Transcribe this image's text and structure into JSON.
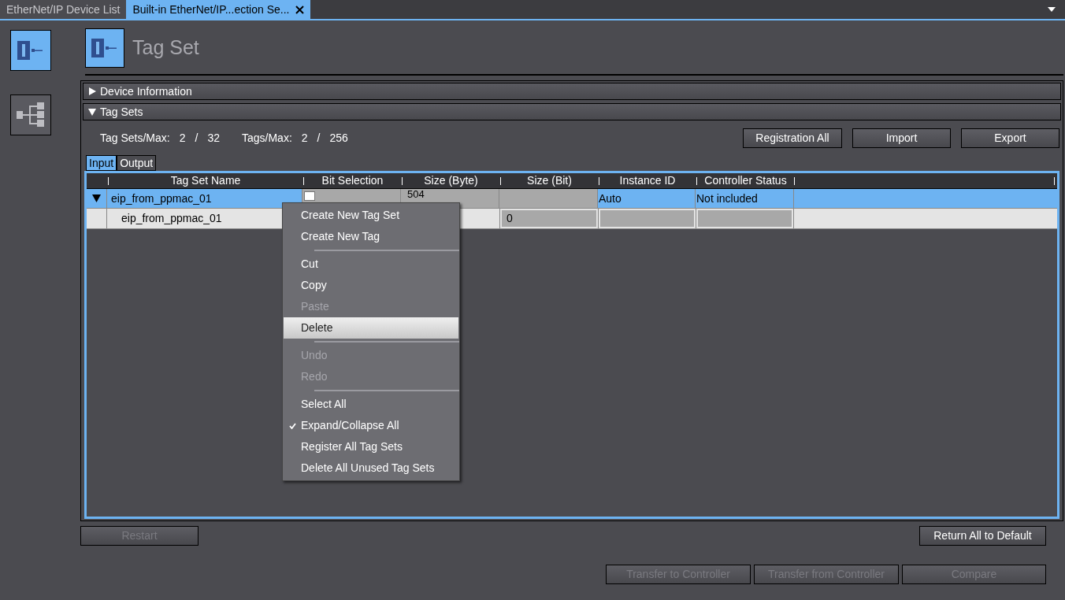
{
  "tabs": [
    {
      "label": "EtherNet/IP Device List",
      "selected": false,
      "closable": false
    },
    {
      "label": "Built-in EtherNet/IP...ection Se...",
      "selected": true,
      "closable": true
    }
  ],
  "sidebar": {
    "items": [
      {
        "kind": "device",
        "selected": true
      },
      {
        "kind": "tree",
        "selected": false
      }
    ]
  },
  "header": {
    "title": "Tag Set"
  },
  "sections": [
    {
      "label": "Device Information",
      "expanded": false
    },
    {
      "label": "Tag Sets",
      "expanded": true
    }
  ],
  "stats": [
    {
      "label": "Tag Sets/Max:",
      "used": "2",
      "sep": "/",
      "max": "32"
    },
    {
      "label": "Tags/Max:",
      "used": "2",
      "sep": "/",
      "max": "256"
    }
  ],
  "toolbar": [
    {
      "label": "Registration All",
      "disabled": false
    },
    {
      "label": "Import",
      "disabled": false
    },
    {
      "label": "Export",
      "disabled": false
    }
  ],
  "subtabs": [
    {
      "label": "Input",
      "selected": true
    },
    {
      "label": "Output",
      "selected": false
    }
  ],
  "table": {
    "columns": [
      "Tag Set Name",
      "Bit Selection",
      "Size (Byte)",
      "Size (Bit)",
      "Instance ID",
      "Controller Status"
    ],
    "rows": [
      {
        "expanded": true,
        "selected": true,
        "name": "eip_from_ppmac_01",
        "bit_selection": {
          "checked": false
        },
        "size_byte": "504",
        "instance_id": "Auto",
        "controller_status": "Not included",
        "children": [
          {
            "name": "eip_from_ppmac_01",
            "size_bit": "0"
          }
        ]
      }
    ]
  },
  "context_menu": [
    {
      "kind": "item",
      "label": "Create New Tag Set",
      "disabled": false,
      "selected": false,
      "checked": false
    },
    {
      "kind": "item",
      "label": "Create New Tag",
      "disabled": false,
      "selected": false,
      "checked": false
    },
    {
      "kind": "separator"
    },
    {
      "kind": "item",
      "label": "Cut",
      "disabled": false,
      "selected": false,
      "checked": false
    },
    {
      "kind": "item",
      "label": "Copy",
      "disabled": false,
      "selected": false,
      "checked": false
    },
    {
      "kind": "item",
      "label": "Paste",
      "disabled": true,
      "selected": false,
      "checked": false
    },
    {
      "kind": "item",
      "label": "Delete",
      "disabled": false,
      "selected": true,
      "checked": false
    },
    {
      "kind": "separator"
    },
    {
      "kind": "item",
      "label": "Undo",
      "disabled": true,
      "selected": false,
      "checked": false
    },
    {
      "kind": "item",
      "label": "Redo",
      "disabled": true,
      "selected": false,
      "checked": false
    },
    {
      "kind": "separator"
    },
    {
      "kind": "item",
      "label": "Select All",
      "disabled": false,
      "selected": false,
      "checked": false
    },
    {
      "kind": "item",
      "label": "Expand/Collapse All",
      "disabled": false,
      "selected": false,
      "checked": true
    },
    {
      "kind": "item",
      "label": "Register All Tag Sets",
      "disabled": false,
      "selected": false,
      "checked": false
    },
    {
      "kind": "item",
      "label": "Delete All Unused Tag Sets",
      "disabled": false,
      "selected": false,
      "checked": false
    }
  ],
  "footer": {
    "left": [
      {
        "label": "Restart",
        "disabled": true
      }
    ],
    "right": [
      {
        "label": "Return All to Default",
        "disabled": false
      }
    ],
    "bottom": [
      {
        "label": "Transfer to Controller",
        "disabled": true
      },
      {
        "label": "Transfer from Controller",
        "disabled": true
      },
      {
        "label": "Compare",
        "disabled": true
      }
    ]
  }
}
